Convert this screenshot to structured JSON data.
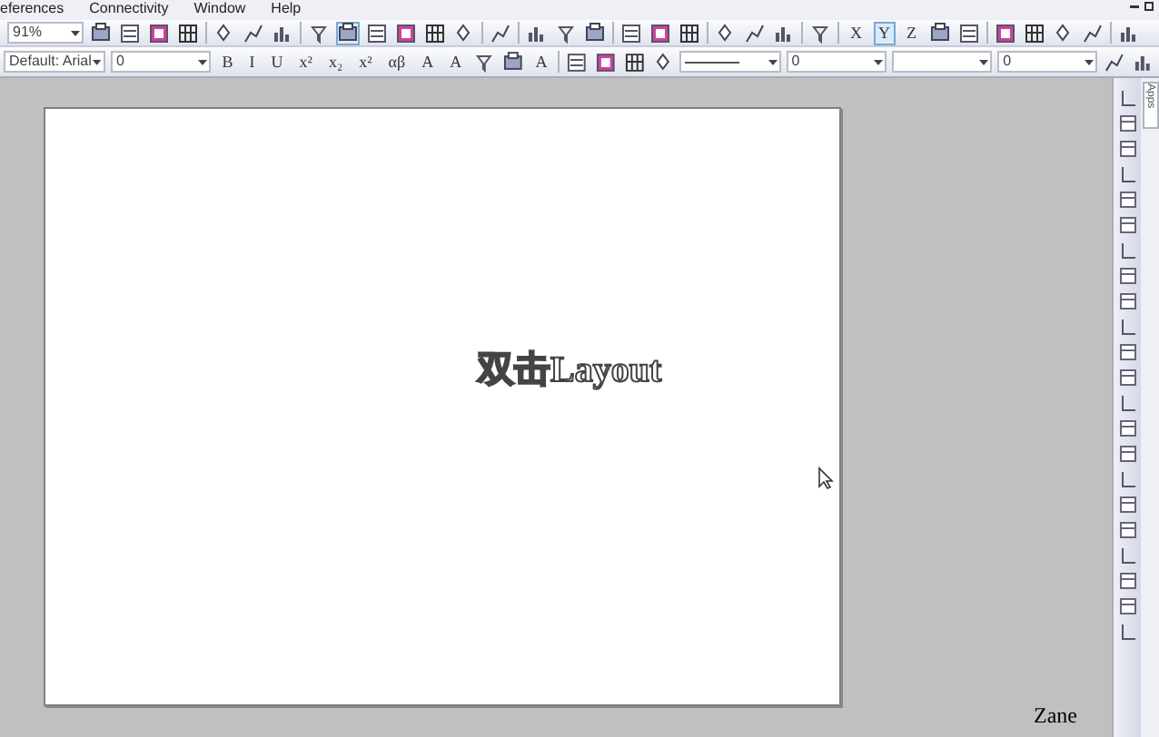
{
  "menu": [
    "eferences",
    "Connectivity",
    "Window",
    "Help"
  ],
  "toolbar_1": [
    {
      "kind": "combo",
      "value": "91%"
    },
    {
      "kind": "icon"
    },
    {
      "kind": "icon"
    },
    {
      "kind": "icon"
    },
    {
      "kind": "icon"
    },
    {
      "kind": "sep"
    },
    {
      "kind": "icon"
    },
    {
      "kind": "icon"
    },
    {
      "kind": "icon"
    },
    {
      "kind": "sep"
    },
    {
      "kind": "icon"
    },
    {
      "kind": "icon",
      "selected": true
    },
    {
      "kind": "icon"
    },
    {
      "kind": "icon"
    },
    {
      "kind": "icon"
    },
    {
      "kind": "icon"
    },
    {
      "kind": "sep"
    },
    {
      "kind": "icon"
    },
    {
      "kind": "sep"
    },
    {
      "kind": "icon"
    },
    {
      "kind": "icon"
    },
    {
      "kind": "icon"
    },
    {
      "kind": "sep"
    },
    {
      "kind": "icon"
    },
    {
      "kind": "icon"
    },
    {
      "kind": "icon"
    },
    {
      "kind": "sep"
    },
    {
      "kind": "icon"
    },
    {
      "kind": "icon"
    },
    {
      "kind": "icon"
    },
    {
      "kind": "sep"
    },
    {
      "kind": "icon"
    },
    {
      "kind": "sep"
    },
    {
      "kind": "text",
      "label": "X",
      "selected": false
    },
    {
      "kind": "text",
      "label": "Y",
      "selected": true
    },
    {
      "kind": "text",
      "label": "Z",
      "selected": false
    },
    {
      "kind": "icon"
    },
    {
      "kind": "icon"
    },
    {
      "kind": "sep"
    },
    {
      "kind": "icon"
    },
    {
      "kind": "icon"
    },
    {
      "kind": "icon"
    },
    {
      "kind": "icon"
    },
    {
      "kind": "sep"
    },
    {
      "kind": "icon"
    }
  ],
  "toolbar_2": [
    {
      "kind": "combo",
      "value": "Default: Arial"
    },
    {
      "kind": "combo",
      "value": "0"
    },
    {
      "kind": "text",
      "label": "B",
      "selected": false
    },
    {
      "kind": "text",
      "label": "I",
      "selected": false
    },
    {
      "kind": "text",
      "label": "U",
      "selected": false
    },
    {
      "kind": "text",
      "label": "x²",
      "selected": false
    },
    {
      "kind": "text",
      "label": "x₂",
      "selected": false
    },
    {
      "kind": "text",
      "label": "x²",
      "selected": false
    },
    {
      "kind": "text",
      "label": "αβ",
      "selected": false
    },
    {
      "kind": "text",
      "label": "A",
      "selected": false
    },
    {
      "kind": "text",
      "label": "A",
      "selected": false
    },
    {
      "kind": "icon"
    },
    {
      "kind": "icon"
    },
    {
      "kind": "text",
      "label": "A",
      "selected": false
    },
    {
      "kind": "sep"
    },
    {
      "kind": "icon"
    },
    {
      "kind": "icon"
    },
    {
      "kind": "icon"
    },
    {
      "kind": "icon"
    },
    {
      "kind": "line_combo"
    },
    {
      "kind": "combo",
      "value": "0"
    },
    {
      "kind": "blank_combo"
    },
    {
      "kind": "combo",
      "value": "0"
    },
    {
      "kind": "icon"
    },
    {
      "kind": "icon"
    }
  ],
  "canvas": {
    "page_text": "双击Layout",
    "author": "Zane"
  },
  "side_tab": "Apps"
}
